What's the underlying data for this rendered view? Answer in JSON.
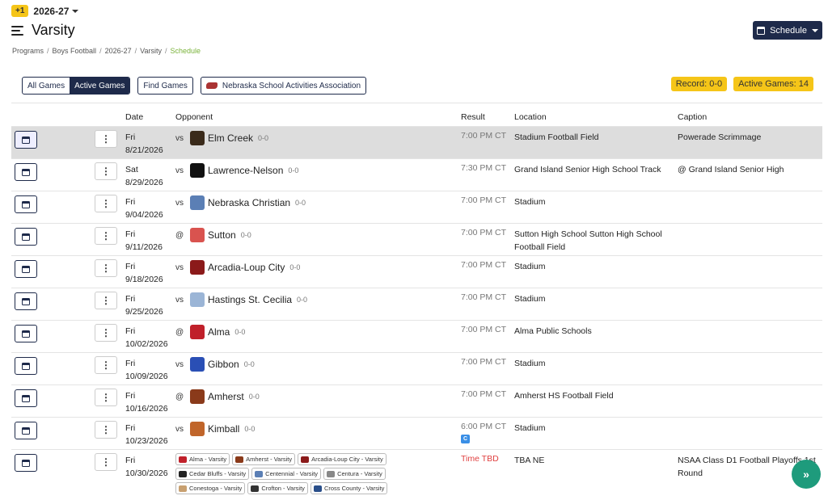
{
  "season": {
    "badge": "+1",
    "label": "2026-27"
  },
  "page_title": "Varsity",
  "schedule_button": "Schedule",
  "breadcrumb": [
    "Programs",
    "Boys Football",
    "2026-27",
    "Varsity",
    "Schedule"
  ],
  "filters": {
    "all": "All Games",
    "active": "Active Games",
    "find": "Find Games",
    "association": "Nebraska School Activities Association"
  },
  "record": "Record: 0-0",
  "active_games": "Active Games: 14",
  "columns": {
    "date": "Date",
    "opponent": "Opponent",
    "result": "Result",
    "location": "Location",
    "caption": "Caption"
  },
  "games": [
    {
      "day": "Fri",
      "date": "8/21/2026",
      "ha": "vs",
      "opponent": "Elm Creek",
      "record": "0-0",
      "result": "7:00 PM CT",
      "location": "Stadium Football Field",
      "caption": "Powerade Scrimmage",
      "logo_color": "#3a2a1a"
    },
    {
      "day": "Sat",
      "date": "8/29/2026",
      "ha": "vs",
      "opponent": "Lawrence-Nelson",
      "record": "0-0",
      "result": "7:30 PM CT",
      "location": "Grand Island Senior High School Track",
      "caption": "@ Grand Island Senior High",
      "logo_color": "#111111"
    },
    {
      "day": "Fri",
      "date": "9/04/2026",
      "ha": "vs",
      "opponent": "Nebraska Christian",
      "record": "0-0",
      "result": "7:00 PM CT",
      "location": "Stadium",
      "caption": "",
      "logo_color": "#5b7fb5"
    },
    {
      "day": "Fri",
      "date": "9/11/2026",
      "ha": "@",
      "opponent": "Sutton",
      "record": "0-0",
      "result": "7:00 PM CT",
      "location": "Sutton High School Sutton High School Football Field",
      "caption": "",
      "logo_color": "#d9534f"
    },
    {
      "day": "Fri",
      "date": "9/18/2026",
      "ha": "vs",
      "opponent": "Arcadia-Loup City",
      "record": "0-0",
      "result": "7:00 PM CT",
      "location": "Stadium",
      "caption": "",
      "logo_color": "#8b1a1a"
    },
    {
      "day": "Fri",
      "date": "9/25/2026",
      "ha": "vs",
      "opponent": "Hastings St. Cecilia",
      "record": "0-0",
      "result": "7:00 PM CT",
      "location": "Stadium",
      "caption": "",
      "logo_color": "#9bb5d6"
    },
    {
      "day": "Fri",
      "date": "10/02/2026",
      "ha": "@",
      "opponent": "Alma",
      "record": "0-0",
      "result": "7:00 PM CT",
      "location": "Alma Public Schools",
      "caption": "",
      "logo_color": "#c0202a"
    },
    {
      "day": "Fri",
      "date": "10/09/2026",
      "ha": "vs",
      "opponent": "Gibbon",
      "record": "0-0",
      "result": "7:00 PM CT",
      "location": "Stadium",
      "caption": "",
      "logo_color": "#2a4fb5"
    },
    {
      "day": "Fri",
      "date": "10/16/2026",
      "ha": "@",
      "opponent": "Amherst",
      "record": "0-0",
      "result": "7:00 PM CT",
      "location": "Amherst HS Football Field",
      "caption": "",
      "logo_color": "#8a3a1a"
    },
    {
      "day": "Fri",
      "date": "10/23/2026",
      "ha": "vs",
      "opponent": "Kimball",
      "record": "0-0",
      "result": "6:00 PM CT",
      "result_badge": "C",
      "location": "Stadium",
      "caption": "",
      "logo_color": "#c0652a"
    }
  ],
  "last_game": {
    "day": "Fri",
    "date": "10/30/2026",
    "result": "Time TBD",
    "location": "TBA NE",
    "caption": "NSAA Class D1 Football Playoffs 1st Round",
    "tags": [
      {
        "label": "Alma - Varsity",
        "color": "#c0202a"
      },
      {
        "label": "Amherst - Varsity",
        "color": "#8a3a1a"
      },
      {
        "label": "Arcadia-Loup City - Varsity",
        "color": "#8b1a1a"
      },
      {
        "label": "Cedar Bluffs - Varsity",
        "color": "#222222"
      },
      {
        "label": "Centennial - Varsity",
        "color": "#5b7fb5"
      },
      {
        "label": "Centura - Varsity",
        "color": "#888888"
      },
      {
        "label": "Conestoga - Varsity",
        "color": "#c8a070"
      },
      {
        "label": "Crofton - Varsity",
        "color": "#333333"
      },
      {
        "label": "Cross County - Varsity",
        "color": "#2a4f8a"
      }
    ]
  }
}
